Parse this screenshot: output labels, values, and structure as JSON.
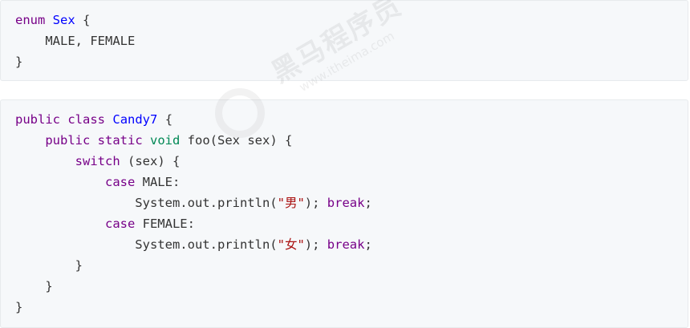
{
  "colors": {
    "keyword": "#770088",
    "type": "#008855",
    "def": "#0000ff",
    "string": "#aa1111",
    "plain": "#333333",
    "background": "#f6f8fa"
  },
  "watermark": {
    "brand_text": "黑马程序员",
    "url_text": "www.itheima.com",
    "icon": "itheima-logo-icon"
  },
  "blocks": [
    {
      "name": "enum-sex",
      "lines": [
        [
          {
            "t": "enum",
            "c": "kw"
          },
          {
            "t": " ",
            "c": "pl"
          },
          {
            "t": "Sex",
            "c": "df"
          },
          {
            "t": " {",
            "c": "pl"
          }
        ],
        [
          {
            "t": "    MALE, FEMALE",
            "c": "pl"
          }
        ],
        [
          {
            "t": "}",
            "c": "pl"
          }
        ]
      ]
    },
    {
      "name": "class-candy7",
      "lines": [
        [
          {
            "t": "public",
            "c": "kw"
          },
          {
            "t": " ",
            "c": "pl"
          },
          {
            "t": "class",
            "c": "kw"
          },
          {
            "t": " ",
            "c": "pl"
          },
          {
            "t": "Candy7",
            "c": "df"
          },
          {
            "t": " {",
            "c": "pl"
          }
        ],
        [
          {
            "t": "    ",
            "c": "pl"
          },
          {
            "t": "public",
            "c": "kw"
          },
          {
            "t": " ",
            "c": "pl"
          },
          {
            "t": "static",
            "c": "kw"
          },
          {
            "t": " ",
            "c": "pl"
          },
          {
            "t": "void",
            "c": "tp"
          },
          {
            "t": " foo(Sex sex) {",
            "c": "pl"
          }
        ],
        [
          {
            "t": "        ",
            "c": "pl"
          },
          {
            "t": "switch",
            "c": "kw"
          },
          {
            "t": " (sex) {",
            "c": "pl"
          }
        ],
        [
          {
            "t": "            ",
            "c": "pl"
          },
          {
            "t": "case",
            "c": "kw"
          },
          {
            "t": " MALE:",
            "c": "pl"
          }
        ],
        [
          {
            "t": "                System.out.println(",
            "c": "pl"
          },
          {
            "t": "\"男\"",
            "c": "st"
          },
          {
            "t": "); ",
            "c": "pl"
          },
          {
            "t": "break",
            "c": "kw"
          },
          {
            "t": ";",
            "c": "pl"
          }
        ],
        [
          {
            "t": "            ",
            "c": "pl"
          },
          {
            "t": "case",
            "c": "kw"
          },
          {
            "t": " FEMALE:",
            "c": "pl"
          }
        ],
        [
          {
            "t": "                System.out.println(",
            "c": "pl"
          },
          {
            "t": "\"女\"",
            "c": "st"
          },
          {
            "t": "); ",
            "c": "pl"
          },
          {
            "t": "break",
            "c": "kw"
          },
          {
            "t": ";",
            "c": "pl"
          }
        ],
        [
          {
            "t": "        }",
            "c": "pl"
          }
        ],
        [
          {
            "t": "    }",
            "c": "pl"
          }
        ],
        [
          {
            "t": "}",
            "c": "pl"
          }
        ]
      ]
    }
  ]
}
